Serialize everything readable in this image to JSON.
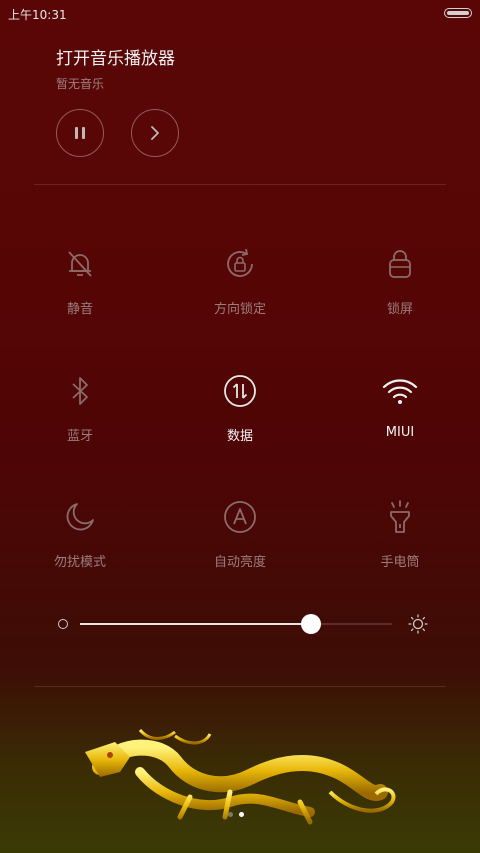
{
  "status_bar": {
    "time": "上午10:31"
  },
  "music": {
    "title": "打开音乐播放器",
    "subtitle": "暂无音乐"
  },
  "toggles": [
    {
      "label": "静音",
      "icon": "silent-bell-icon",
      "active": false
    },
    {
      "label": "方向锁定",
      "icon": "rotation-lock-icon",
      "active": false
    },
    {
      "label": "锁屏",
      "icon": "lock-icon",
      "active": false
    },
    {
      "label": "蓝牙",
      "icon": "bluetooth-icon",
      "active": false
    },
    {
      "label": "数据",
      "icon": "mobile-data-icon",
      "active": true
    },
    {
      "label": "MIUI",
      "icon": "wifi-icon",
      "active": true
    },
    {
      "label": "勿扰模式",
      "icon": "moon-icon",
      "active": false
    },
    {
      "label": "自动亮度",
      "icon": "auto-brightness-icon",
      "active": false
    },
    {
      "label": "手电筒",
      "icon": "flashlight-icon",
      "active": false
    }
  ],
  "brightness": {
    "level_percent": 74
  },
  "pager": {
    "pages": 2,
    "current": 2
  },
  "colors": {
    "active": "#f2f2f2",
    "inactive": "#9a7d7d"
  }
}
